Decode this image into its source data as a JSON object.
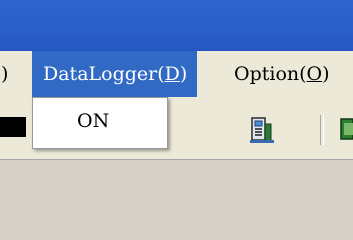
{
  "menubar": {
    "items": [
      {
        "label_prefix": ")",
        "mnemonic": "",
        "label_suffix": ""
      },
      {
        "label_prefix": "DataLogger(",
        "mnemonic": "D",
        "label_suffix": ")"
      },
      {
        "label_prefix": "Option(",
        "mnemonic": "O",
        "label_suffix": ")"
      }
    ],
    "selected_color": "#316ac5"
  },
  "dropdown": {
    "items": [
      {
        "label": "ON"
      }
    ]
  },
  "toolbar": {
    "icons": [
      "color-swatch-icon",
      "datalogger-icon",
      "window-icon"
    ]
  },
  "colors": {
    "titlebar": "#2a60c8",
    "menubar": "#ece9d8",
    "client": "#d4d0c8"
  }
}
